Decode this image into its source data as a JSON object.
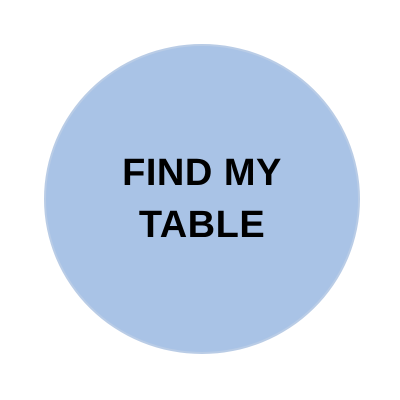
{
  "button": {
    "line1": "FIND MY",
    "line2": "TABLE"
  },
  "colors": {
    "background": "#ffffff",
    "circle_fill": "#a9c3e6",
    "circle_border": "#b9cce6",
    "text": "#000000"
  }
}
